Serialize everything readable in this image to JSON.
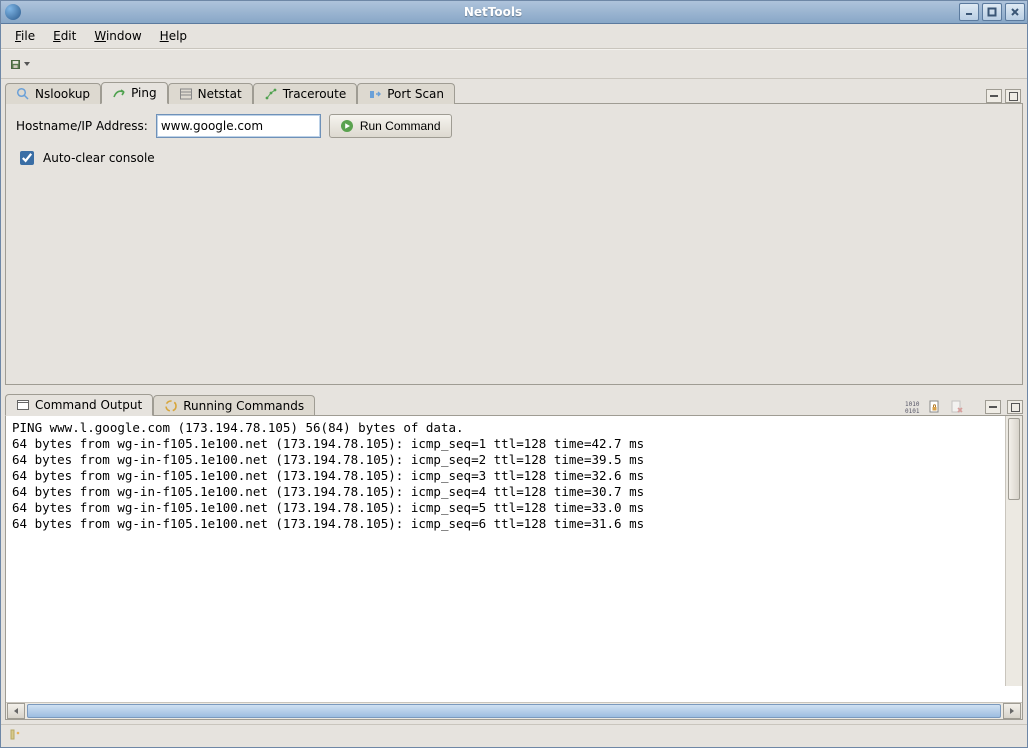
{
  "window": {
    "title": "NetTools"
  },
  "menu": {
    "file": "File",
    "edit": "Edit",
    "window": "Window",
    "help": "Help"
  },
  "tabs_top": {
    "nslookup": "Nslookup",
    "ping": "Ping",
    "netstat": "Netstat",
    "traceroute": "Traceroute",
    "portscan": "Port Scan",
    "active": "ping"
  },
  "ping_form": {
    "hostname_label": "Hostname/IP Address:",
    "hostname_value": "www.google.com",
    "run_label": "Run Command",
    "autoclear_label": "Auto-clear console",
    "autoclear_checked": true
  },
  "tabs_bottom": {
    "output": "Command Output",
    "running": "Running Commands",
    "active": "output"
  },
  "output_lines": [
    "PING www.l.google.com (173.194.78.105) 56(84) bytes of data.",
    "64 bytes from wg-in-f105.1e100.net (173.194.78.105): icmp_seq=1 ttl=128 time=42.7 ms",
    "64 bytes from wg-in-f105.1e100.net (173.194.78.105): icmp_seq=2 ttl=128 time=39.5 ms",
    "64 bytes from wg-in-f105.1e100.net (173.194.78.105): icmp_seq=3 ttl=128 time=32.6 ms",
    "64 bytes from wg-in-f105.1e100.net (173.194.78.105): icmp_seq=4 ttl=128 time=30.7 ms",
    "64 bytes from wg-in-f105.1e100.net (173.194.78.105): icmp_seq=5 ttl=128 time=33.0 ms",
    "64 bytes from wg-in-f105.1e100.net (173.194.78.105): icmp_seq=6 ttl=128 time=31.6 ms"
  ]
}
